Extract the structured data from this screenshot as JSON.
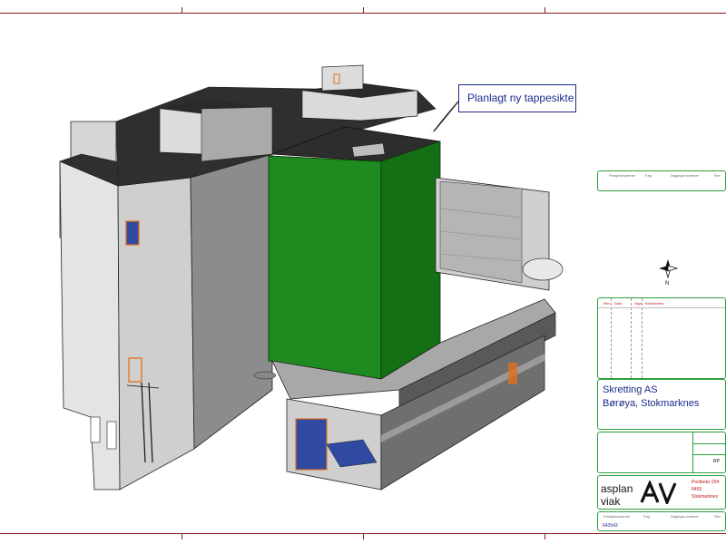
{
  "callout": {
    "label": "Planlagt ny tappesikte"
  },
  "compass": {
    "north_label": "N"
  },
  "revision_table": {
    "headers": [
      "Rev.",
      "Dato",
      "Sign",
      "Beskrivelse"
    ]
  },
  "header_fields": [
    "Prosjektnummer",
    "Fag",
    "Dagtegn.nummer",
    "Rev"
  ],
  "client": {
    "company": "Skretting AS",
    "location": "Børøya, Stokmarknes"
  },
  "signature": {
    "initials": "RP"
  },
  "logo": {
    "line1": "asplan",
    "line2": "viak",
    "mark": "AV"
  },
  "address": {
    "line1": "Postboks 204",
    "line2": "8455 Stokmarknes"
  },
  "footer_fields": [
    "Prosjektnummer",
    "Fag",
    "Dagtegn.nummer",
    "Rev"
  ],
  "project_number": "643543",
  "colors": {
    "accent_green": "#2e9e3a",
    "frame_red": "#8b1a1a",
    "text_blue": "#1b2a8a",
    "highlight_green": "#1f8a1f"
  }
}
